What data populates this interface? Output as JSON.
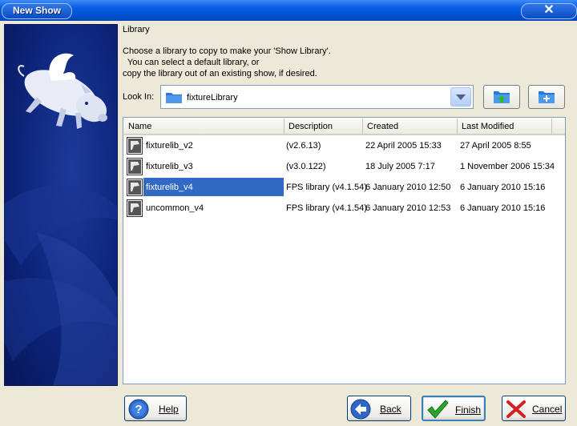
{
  "window": {
    "title": "New Show",
    "close_glyph": "✕"
  },
  "section_title": "Library",
  "intro_lines": [
    "Choose a library to copy to make your 'Show Library'.",
    "  You can select a default library, or",
    "copy the library out of an existing show, if desired."
  ],
  "look_in": {
    "label": "Look In:",
    "value": "fixtureLibrary",
    "icon": "folder-icon"
  },
  "toolbar": {
    "up_icon": "folder-up-icon",
    "new_folder_icon": "new-folder-icon"
  },
  "table": {
    "columns": [
      "Name",
      "Description",
      "Created",
      "Last Modified"
    ],
    "rows": [
      {
        "name": "fixturelib_v2",
        "description": " (v2.6.13)",
        "created": "22 April 2005 15:33",
        "modified": "27 April 2005 8:55",
        "selected": false
      },
      {
        "name": "fixturelib_v3",
        "description": " (v3.0.122)",
        "created": "18 July 2005 7:17",
        "modified": "1 November 2006 15:34",
        "selected": false
      },
      {
        "name": "fixturelib_v4",
        "description": "FPS library  (v4.1.54)",
        "created": "6 January 2010 12:50",
        "modified": "6 January 2010 15:16",
        "selected": true
      },
      {
        "name": "uncommon_v4",
        "description": "FPS library  (v4.1.54)",
        "created": "6 January 2010 12:53",
        "modified": "6 January 2010 15:16",
        "selected": false
      }
    ]
  },
  "buttons": {
    "help": "Help",
    "back": "Back",
    "finish": "Finish",
    "cancel": "Cancel"
  },
  "colors": {
    "selection": "#316ac5",
    "title_bar": "#0053d6",
    "banner": "#0d247a"
  }
}
